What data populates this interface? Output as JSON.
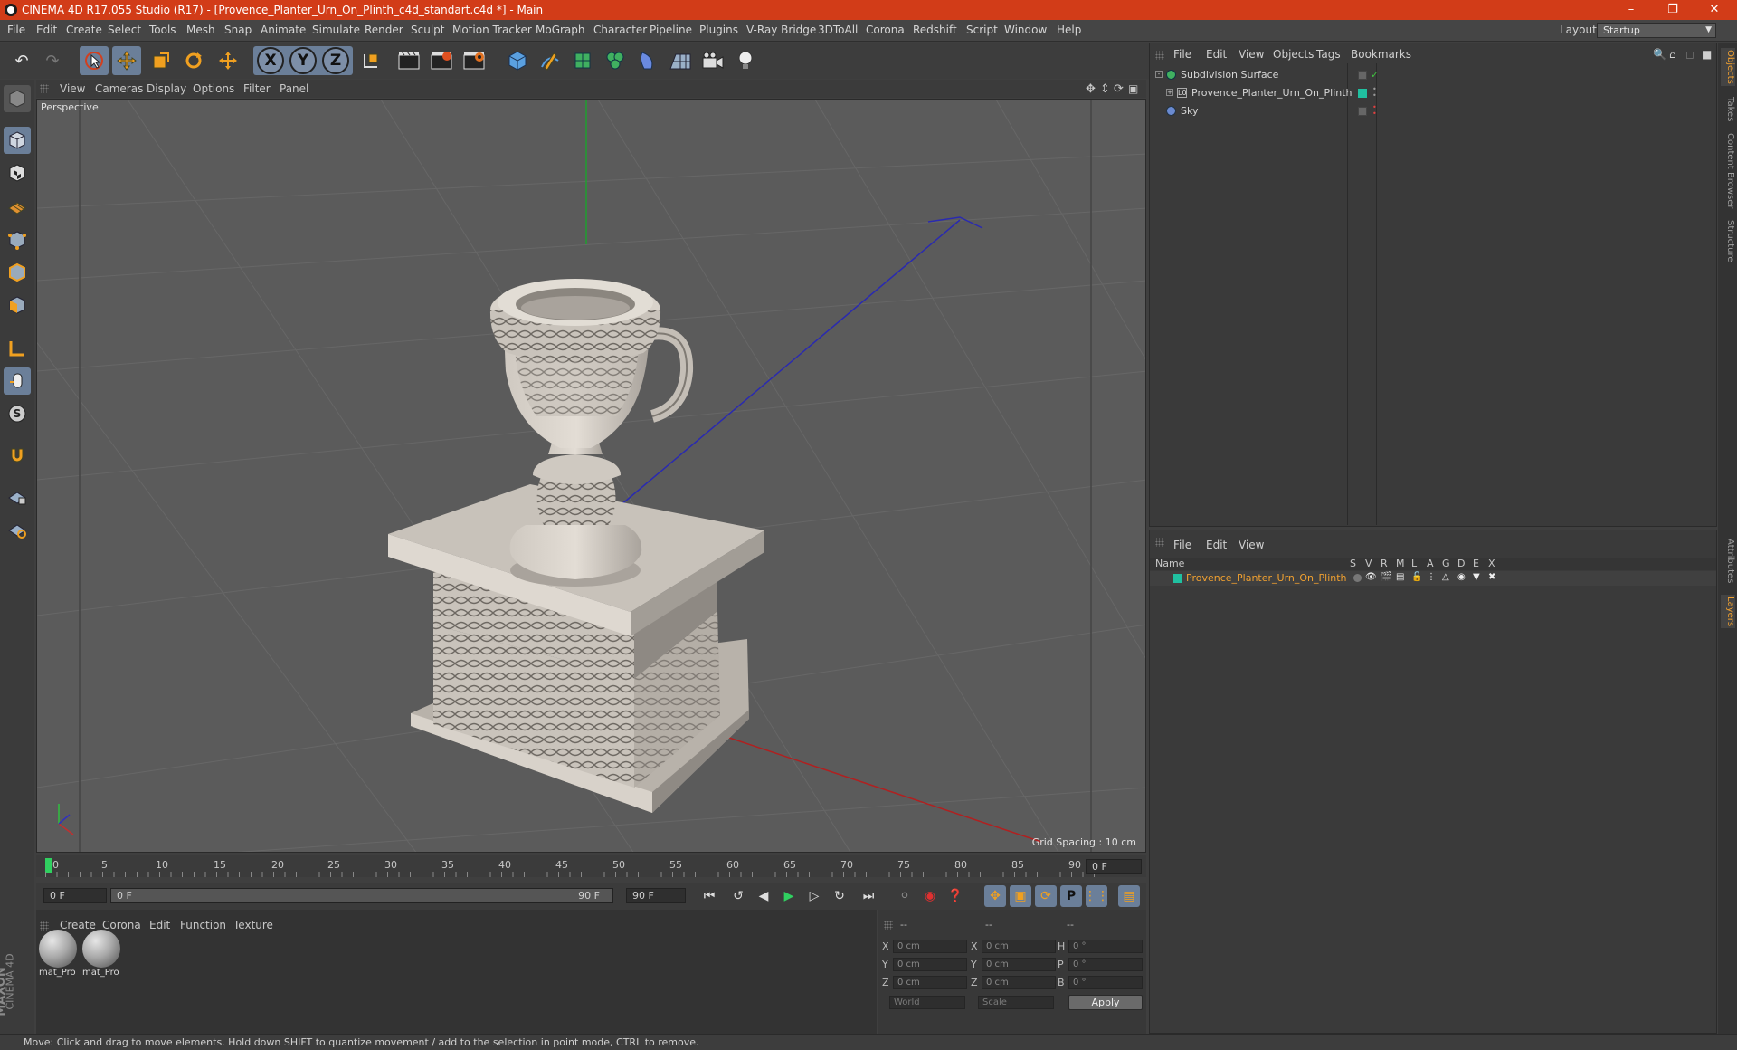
{
  "window": {
    "title": "CINEMA 4D R17.055 Studio (R17) - [Provence_Planter_Urn_On_Plinth_c4d_standart.c4d *] - Main",
    "minimize": "–",
    "restore": "❐",
    "close": "✕"
  },
  "menubar": {
    "items": [
      "File",
      "Edit",
      "Create",
      "Select",
      "Tools",
      "Mesh",
      "Snap",
      "Animate",
      "Simulate",
      "Render",
      "Sculpt",
      "Motion Tracker",
      "MoGraph",
      "Character",
      "Pipeline",
      "Plugins",
      "V-Ray Bridge",
      "3DToAll",
      "Corona",
      "Redshift",
      "Script",
      "Window",
      "Help"
    ],
    "layout_label": "Layout:",
    "layout_value": "Startup"
  },
  "toolbar": {
    "axis_x": "X",
    "axis_y": "Y",
    "axis_z": "Z"
  },
  "viewport": {
    "menu": [
      "View",
      "Cameras",
      "Display",
      "Options",
      "Filter",
      "Panel"
    ],
    "camera_label": "Perspective",
    "grid_spacing": "Grid Spacing : 10 cm"
  },
  "timeline": {
    "ticks": [
      "0",
      "5",
      "10",
      "15",
      "20",
      "25",
      "30",
      "35",
      "40",
      "45",
      "50",
      "55",
      "60",
      "65",
      "70",
      "75",
      "80",
      "85",
      "90"
    ],
    "current_frame": "0 F"
  },
  "transport": {
    "start_field": "0 F",
    "range_start": "0 F",
    "range_end": "90 F",
    "end_field": "90 F"
  },
  "materials": {
    "menu": [
      "Create",
      "Corona",
      "Edit",
      "Function",
      "Texture"
    ],
    "items": [
      {
        "label": "mat_Pro"
      },
      {
        "label": "mat_Pro"
      }
    ]
  },
  "coordinates": {
    "headers": [
      "--",
      "--",
      "--"
    ],
    "rows": [
      {
        "pos_label": "X",
        "pos": "0 cm",
        "size_label": "X",
        "size": "0 cm",
        "rot_label": "H",
        "rot": "0 °"
      },
      {
        "pos_label": "Y",
        "pos": "0 cm",
        "size_label": "Y",
        "size": "0 cm",
        "rot_label": "P",
        "rot": "0 °"
      },
      {
        "pos_label": "Z",
        "pos": "0 cm",
        "size_label": "Z",
        "size": "0 cm",
        "rot_label": "B",
        "rot": "0 °"
      }
    ],
    "space": "World",
    "mode": "Scale",
    "apply": "Apply"
  },
  "status": "Move: Click and drag to move elements. Hold down SHIFT to quantize movement / add to the selection in point mode, CTRL to remove.",
  "objects_panel": {
    "menu": [
      "File",
      "Edit",
      "View",
      "Objects",
      "Tags",
      "Bookmarks"
    ],
    "objects": [
      {
        "name": "Subdivision Surface"
      },
      {
        "name": "Provence_Planter_Urn_On_Plinth"
      },
      {
        "name": "Sky"
      }
    ]
  },
  "layers_panel": {
    "menu": [
      "File",
      "Edit",
      "View"
    ],
    "columns": [
      "Name",
      "S",
      "V",
      "R",
      "M",
      "L",
      "A",
      "G",
      "D",
      "E",
      "X"
    ],
    "layer_name": "Provence_Planter_Urn_On_Plinth",
    "accent_color": "#f0a030"
  },
  "side_tabs": [
    "Objects",
    "Takes",
    "Content Browser",
    "Structure",
    "Attributes",
    "Layers"
  ],
  "brand": {
    "line1": "MAXON",
    "line2": "CINEMA 4D"
  }
}
